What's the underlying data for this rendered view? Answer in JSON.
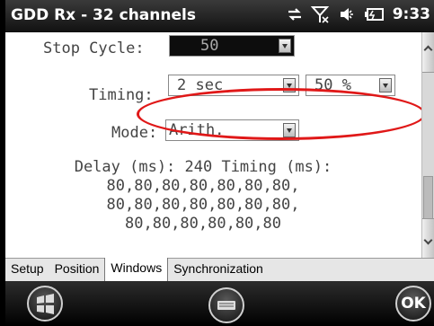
{
  "statusbar": {
    "title": "GDD Rx - 32 channels",
    "clock": "9:33",
    "icons": [
      "connectivity-icon",
      "no-signal-icon",
      "volume-icon",
      "battery-icon"
    ]
  },
  "form": {
    "stop_cycle": {
      "label": "Stop Cycle:",
      "value": "50"
    },
    "timing": {
      "label": "Timing:",
      "value": "2 sec",
      "percent_value": "50 %"
    },
    "mode": {
      "label": "Mode:",
      "value": "Arith."
    }
  },
  "info": {
    "line1": "Delay (ms): 240 Timing (ms):",
    "line2": "80,80,80,80,80,80,80,",
    "line3": "80,80,80,80,80,80,80,",
    "line4": "80,80,80,80,80,80"
  },
  "tabs": [
    {
      "label": "Setup",
      "active": false
    },
    {
      "label": "Position",
      "active": false
    },
    {
      "label": "Windows",
      "active": true
    },
    {
      "label": "Synchronization",
      "active": false
    }
  ],
  "softkeys": {
    "ok_label": "OK"
  },
  "colors": {
    "highlight_ellipse": "#e01818",
    "statusbar": "#1a1a1a"
  }
}
